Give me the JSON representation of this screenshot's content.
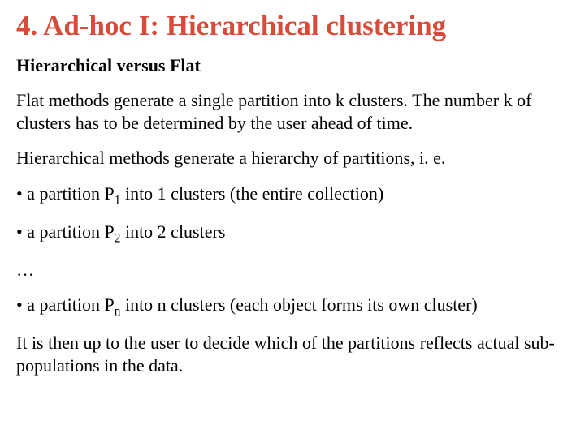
{
  "title": "4. Ad-hoc I: Hierarchical clustering",
  "subtitle": "Hierarchical versus Flat",
  "para1": "Flat methods generate a single partition into k clusters. The number k of clusters has to be determined by the user ahead of time.",
  "para2": "Hierarchical methods generate a hierarchy of partitions, i. e.",
  "bullet1_pre": "• a partition P",
  "bullet1_sub": "1",
  "bullet1_post": " into 1 clusters (the entire collection)",
  "bullet2_pre": "• a partition P",
  "bullet2_sub": "2",
  "bullet2_post": "  into 2 clusters",
  "ellipsis": "…",
  "bullet3_pre": "• a partition P",
  "bullet3_sub": "n",
  "bullet3_post": " into n clusters (each object forms its own cluster)",
  "para3": "It is then up to the user to decide which of the partitions reflects actual sub-populations in the data."
}
